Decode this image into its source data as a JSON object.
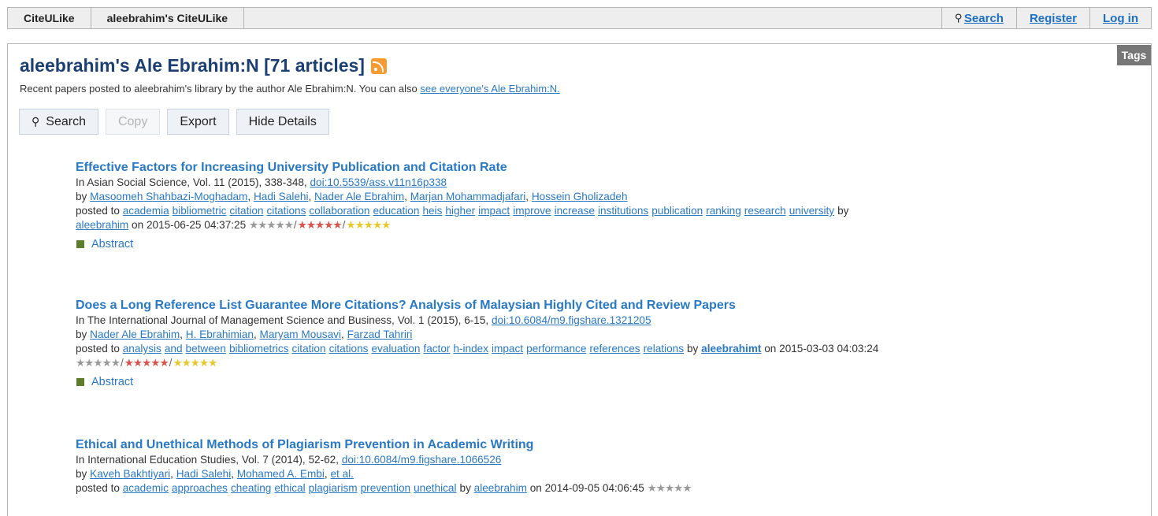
{
  "topbar": {
    "tabs": [
      "CiteULike",
      "aleebrahim's CiteULike"
    ],
    "search_label": "Search",
    "register_label": "Register",
    "login_label": "Log in"
  },
  "tags_tab": "Tags",
  "header": {
    "title": "aleebrahim's Ale Ebrahim:N [71 articles]",
    "subtitle_text": "Recent papers posted to aleebrahim's library by the author Ale Ebrahim:N. You can also ",
    "subtitle_link": "see everyone's Ale Ebrahim:N."
  },
  "buttons": {
    "search": "Search",
    "copy": "Copy",
    "export": "Export",
    "hide_details": "Hide Details"
  },
  "articles": [
    {
      "title": "Effective Factors for Increasing University Publication and Citation Rate",
      "source": "In Asian Social Science, Vol. 11 (2015), 338-348, ",
      "doi": "doi:10.5539/ass.v11n16p338",
      "by": "by ",
      "authors": [
        "Masoomeh Shahbazi-Moghadam",
        "Hadi Salehi",
        "Nader Ale Ebrahim",
        "Marjan Mohammadjafari",
        "Hossein Gholizadeh"
      ],
      "posted_to": "posted to ",
      "tags": [
        "academia",
        "bibliometric",
        "citation",
        "citations",
        "collaboration",
        "education",
        "heis",
        "higher",
        "impact",
        "improve",
        "increase",
        "institutions",
        "publication",
        "ranking",
        "research",
        "university"
      ],
      "by_user_prefix": "by",
      "user": "aleebrahim",
      "date": "on 2015-06-25 04:37:25",
      "abstract_label": "Abstract"
    },
    {
      "title": "Does a Long Reference List Guarantee More Citations? Analysis of Malaysian Highly Cited and Review Papers",
      "source": "In The International Journal of Management Science and Business, Vol. 1 (2015), 6-15, ",
      "doi": "doi:10.6084/m9.figshare.1321205",
      "by": "by ",
      "authors": [
        "Nader Ale Ebrahim",
        "H. Ebrahimian",
        "Maryam Mousavi",
        "Farzad Tahriri"
      ],
      "posted_to": "posted to ",
      "tags": [
        "analysis",
        "and",
        "between",
        "bibliometrics",
        "citation",
        "citations",
        "evaluation",
        "factor",
        "h-index",
        "impact",
        "performance",
        "references",
        "relations"
      ],
      "by_user_prefix": "by",
      "user": "aleebrahimt",
      "date": "on 2015-03-03 04:03:24",
      "abstract_label": "Abstract"
    },
    {
      "title": "Ethical and Unethical Methods of Plagiarism Prevention in Academic Writing",
      "source": "In International Education Studies, Vol. 7 (2014), 52-62, ",
      "doi": "doi:10.6084/m9.figshare.1066526",
      "by": "by ",
      "authors": [
        "Kaveh Bakhtiyari",
        "Hadi Salehi",
        "Mohamed A. Embi",
        "et al."
      ],
      "posted_to": "posted to ",
      "tags": [
        "academic",
        "approaches",
        "cheating",
        "ethical",
        "plagiarism",
        "prevention",
        "unethical"
      ],
      "by_user_prefix": "by",
      "user": "aleebrahim",
      "date": "on 2014-09-05 04:06:45"
    }
  ],
  "rating": {
    "stars": "★★★★★",
    "separator": "/"
  },
  "colors": {
    "link": "#2a79c4",
    "title": "#1b3f73",
    "tag": "#6b1f1f",
    "rss": "#f79a31",
    "abstract_marker": "#5e7d2b"
  }
}
